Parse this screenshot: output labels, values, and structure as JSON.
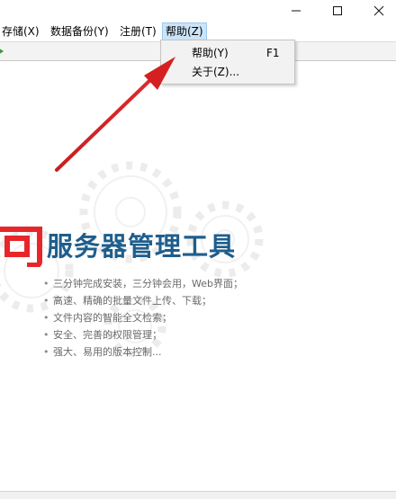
{
  "window": {
    "controls": [
      "minimize-icon",
      "maximize-icon",
      "close-icon"
    ]
  },
  "menubar": {
    "items": [
      {
        "label": "存储(X)"
      },
      {
        "label": "数据备份(Y)"
      },
      {
        "label": "注册(T)"
      },
      {
        "label": "帮助(Z)",
        "active": true
      }
    ]
  },
  "dropdown": {
    "items": [
      {
        "label": "帮助(Y)",
        "accelerator": "F1"
      },
      {
        "label": "关于(Z)...",
        "accelerator": ""
      }
    ]
  },
  "splash": {
    "logo_char": "可",
    "title": "服务器管理工具",
    "features": [
      "三分钟完成安装，三分钟会用，Web界面；",
      "高速、精确的批量文件上传、下载；",
      "文件内容的智能全文检索；",
      "安全、完善的权限管理；",
      "强大、易用的版本控制..."
    ]
  },
  "colors": {
    "title_blue": "#1e5e8c",
    "logo_red": "#e8262a",
    "arrow_red": "#d42020",
    "menu_highlight": "#cce4f7"
  }
}
